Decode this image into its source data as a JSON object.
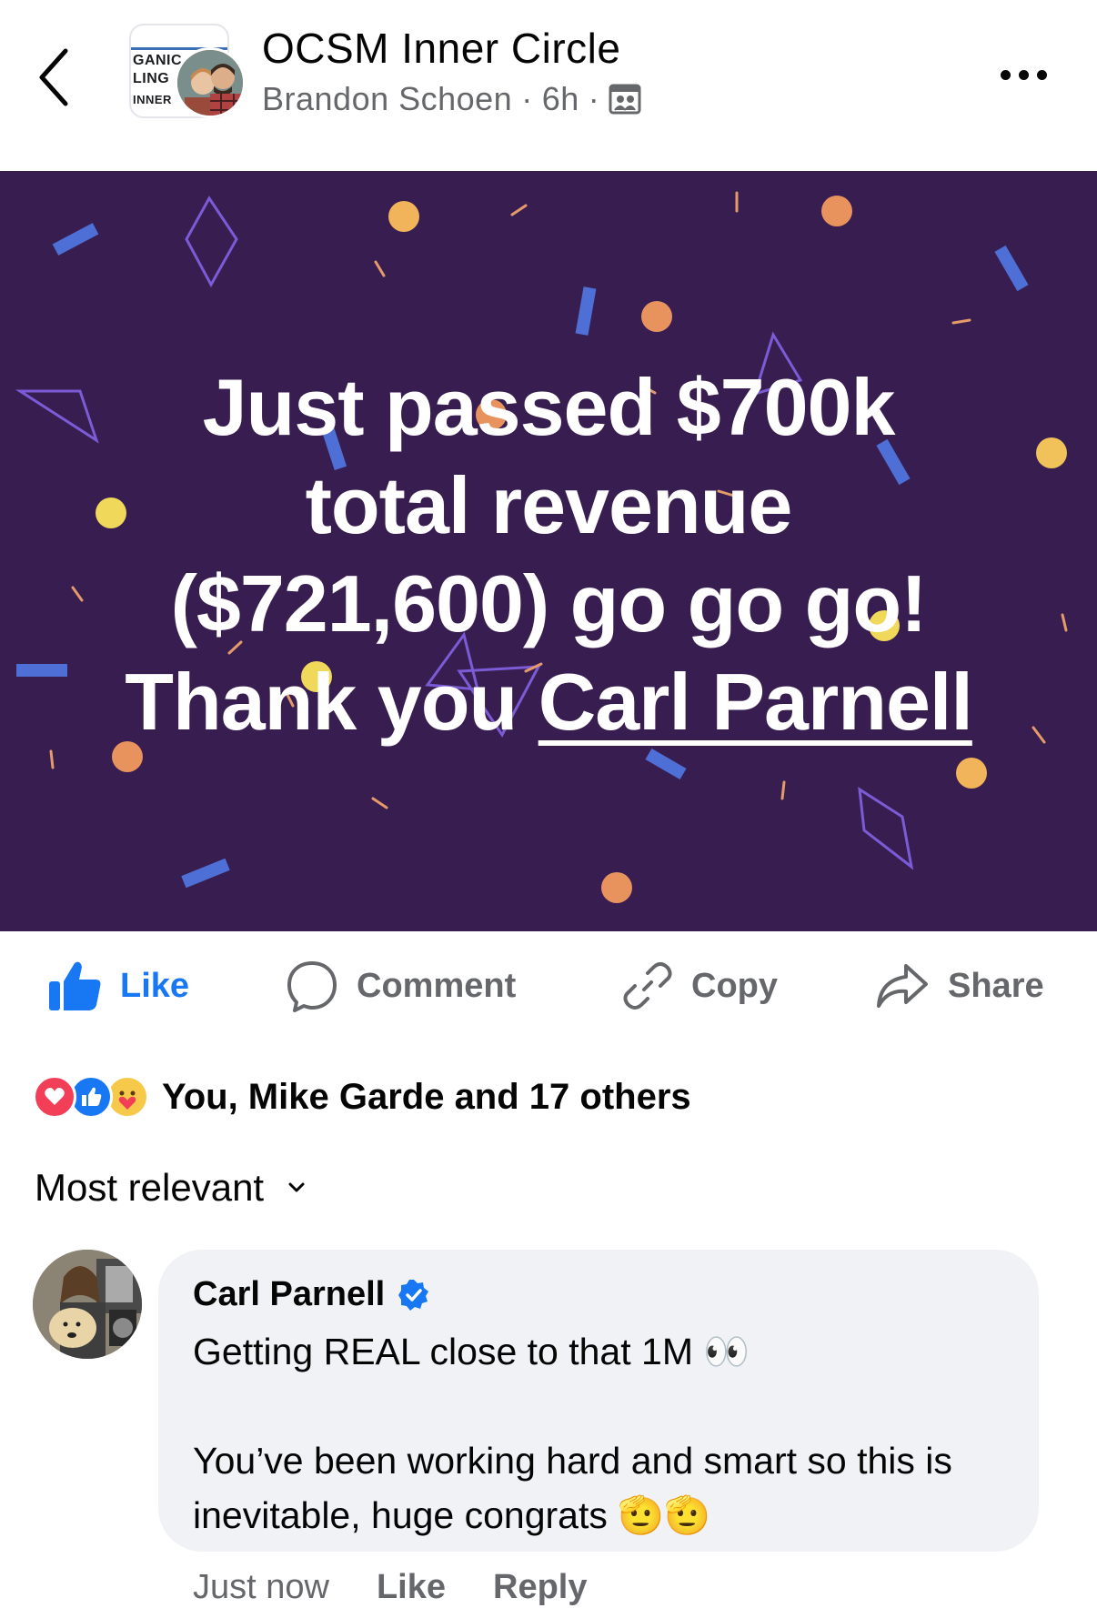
{
  "header": {
    "group_name": "OCSM Inner Circle",
    "author": "Brandon Schoen",
    "separator": "·",
    "time": "6h",
    "logo_text": [
      "GANIC",
      "LING",
      "INNER"
    ]
  },
  "post": {
    "banner_lines": [
      "Just passed $700k",
      "total revenue",
      "($721,600) go go go!"
    ],
    "banner_thank": "Thank you ",
    "banner_mention": "Carl Parnell",
    "banner_bg": "#381e50"
  },
  "actions": {
    "like": "Like",
    "comment": "Comment",
    "copy": "Copy",
    "share": "Share"
  },
  "reactions": {
    "summary": "You, Mike Garde and 17 others",
    "types": [
      "love",
      "like",
      "care"
    ]
  },
  "sort": {
    "label": "Most relevant"
  },
  "comment": {
    "author": "Carl Parnell",
    "line1": "Getting REAL close to that 1M 👀",
    "line2": "You’ve been working hard and smart so this is inevitable, huge congrats 🫡🫡",
    "time": "Just now",
    "like": "Like",
    "reply": "Reply"
  }
}
